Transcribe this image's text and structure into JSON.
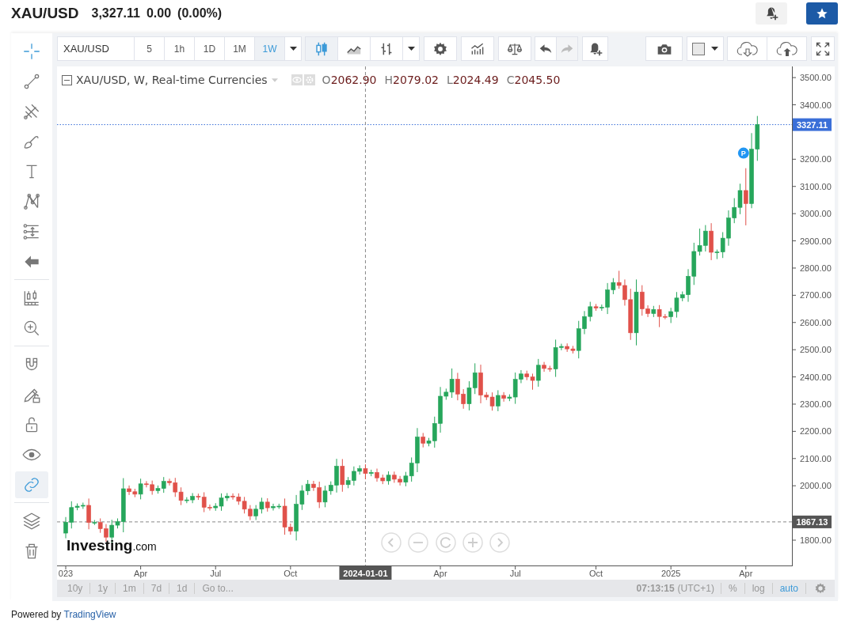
{
  "header": {
    "symbol": "XAU/USD",
    "price": "3,327.11",
    "change": "0.00",
    "change_percent": "(0.00%)"
  },
  "toolbar": {
    "symbol": "XAU/USD",
    "intervals": [
      {
        "label": "5",
        "selected": false
      },
      {
        "label": "1h",
        "selected": false
      },
      {
        "label": "1D",
        "selected": false
      },
      {
        "label": "1M",
        "selected": false
      },
      {
        "label": "1W",
        "selected": true
      }
    ],
    "chart_types": [
      {
        "kind": "candles",
        "selected": true
      },
      {
        "kind": "area",
        "selected": false
      },
      {
        "kind": "bars",
        "selected": false
      }
    ],
    "undo": {
      "disabled": false
    },
    "redo": {
      "disabled": true
    }
  },
  "left_toolbar": {
    "groups": [
      [
        {
          "kind": "crosshair",
          "active": true
        },
        {
          "kind": "trend-line",
          "active": false
        },
        {
          "kind": "pitchfork",
          "active": false
        },
        {
          "kind": "brush",
          "active": false
        },
        {
          "kind": "text",
          "active": false
        },
        {
          "kind": "pattern",
          "active": false
        },
        {
          "kind": "fib",
          "active": false
        },
        {
          "kind": "arrow",
          "active": false
        }
      ],
      [
        {
          "kind": "measure",
          "active": false
        },
        {
          "kind": "zoom",
          "active": false
        }
      ],
      [
        {
          "kind": "magnet",
          "active": false
        },
        {
          "kind": "pencil-lock",
          "active": false
        },
        {
          "kind": "lock",
          "active": false
        },
        {
          "kind": "eye",
          "active": false
        },
        {
          "kind": "link",
          "active": true
        }
      ],
      [
        {
          "kind": "layers",
          "active": false
        },
        {
          "kind": "trash",
          "active": false
        }
      ]
    ]
  },
  "legend": {
    "title": "XAU/USD, W, Real-time Currencies",
    "values": [
      {
        "label": "O",
        "value": "2062.90"
      },
      {
        "label": "H",
        "value": "2079.02"
      },
      {
        "label": "L",
        "value": "2024.49"
      },
      {
        "label": "C",
        "value": "2045.50"
      }
    ]
  },
  "price_axis": {
    "crosshair_price": "1867.13"
  },
  "crosshair": {
    "time": "2024-01-01"
  },
  "marker": {
    "label": "P"
  },
  "chart": {
    "logo": {
      "name": "Investing",
      "suffix": ".com"
    },
    "chart_data": {
      "type": "candlestick",
      "ylim": [
        1707,
        3541
      ],
      "ref_lines": [
        {
          "axis": "y",
          "value": 3327.11,
          "label": "3327.11",
          "color": "#3a6fd8"
        }
      ],
      "yticks": [
        {
          "value": 1800,
          "label": "1800.00"
        },
        {
          "value": 2000,
          "label": "2000.00"
        },
        {
          "value": 2100,
          "label": "2100.00"
        },
        {
          "value": 2200,
          "label": "2200.00"
        },
        {
          "value": 2300,
          "label": "2300.00"
        },
        {
          "value": 2400,
          "label": "2400.00"
        },
        {
          "value": 2500,
          "label": "2500.00"
        },
        {
          "value": 2600,
          "label": "2600.00"
        },
        {
          "value": 2700,
          "label": "2700.00"
        },
        {
          "value": 2800,
          "label": "2800.00"
        },
        {
          "value": 2900,
          "label": "2900.00"
        },
        {
          "value": 3000,
          "label": "3000.00"
        },
        {
          "value": 3100,
          "label": "3100.00"
        },
        {
          "value": 3200,
          "label": "3200.00"
        },
        {
          "value": 3400,
          "label": "3400.00"
        },
        {
          "value": 3500,
          "label": "3500.00"
        }
      ],
      "categories": [
        "023",
        null,
        null,
        null,
        null,
        null,
        null,
        null,
        null,
        null,
        null,
        null,
        null,
        "Apr",
        null,
        null,
        null,
        null,
        null,
        null,
        null,
        null,
        null,
        null,
        null,
        null,
        "Jul",
        null,
        null,
        null,
        null,
        null,
        null,
        null,
        null,
        null,
        null,
        null,
        null,
        "Oct",
        null,
        null,
        null,
        null,
        null,
        null,
        null,
        null,
        null,
        null,
        null,
        null,
        null,
        null,
        null,
        null,
        null,
        null,
        null,
        null,
        null,
        null,
        null,
        null,
        null,
        "Apr",
        null,
        null,
        null,
        null,
        null,
        null,
        null,
        null,
        null,
        null,
        null,
        null,
        "Jul",
        null,
        null,
        null,
        null,
        null,
        null,
        null,
        null,
        null,
        null,
        null,
        null,
        null,
        "Oct",
        null,
        null,
        null,
        null,
        null,
        null,
        null,
        null,
        null,
        null,
        null,
        null,
        "2025",
        null,
        null,
        null,
        null,
        null,
        null,
        null,
        null,
        null,
        null,
        null,
        null,
        "Apr",
        null,
        null
      ],
      "ohlc": [
        [
          1826,
          1885,
          1807,
          1866
        ],
        [
          1866,
          1943,
          1843,
          1920
        ],
        [
          1920,
          1935,
          1910,
          1925
        ],
        [
          1925,
          1938,
          1915,
          1928
        ],
        [
          1928,
          1953,
          1840,
          1865
        ],
        [
          1865,
          1874,
          1856,
          1865
        ],
        [
          1865,
          1880,
          1827,
          1842
        ],
        [
          1842,
          1859,
          1794,
          1811
        ],
        [
          1811,
          1875,
          1791,
          1855
        ],
        [
          1855,
          1880,
          1843,
          1868
        ],
        [
          1868,
          2028,
          1829,
          1989
        ],
        [
          1989,
          2001,
          1966,
          1978
        ],
        [
          1978,
          1989,
          1958,
          1969
        ],
        [
          1969,
          2026,
          1950,
          2007
        ],
        [
          2007,
          2017,
          1994,
          2004
        ],
        [
          2004,
          2019,
          1967,
          1982
        ],
        [
          1982,
          2001,
          1971,
          1990
        ],
        [
          1990,
          2032,
          1974,
          2016
        ],
        [
          2016,
          2026,
          2001,
          2011
        ],
        [
          2011,
          2029,
          1959,
          1977
        ],
        [
          1977,
          1994,
          1929,
          1946
        ],
        [
          1946,
          1958,
          1936,
          1948
        ],
        [
          1948,
          1973,
          1936,
          1961
        ],
        [
          1961,
          1971,
          1948,
          1958
        ],
        [
          1958,
          1976,
          1903,
          1921
        ],
        [
          1921,
          1931,
          1909,
          1919
        ],
        [
          1919,
          1936,
          1908,
          1925
        ],
        [
          1925,
          1972,
          1908,
          1955
        ],
        [
          1955,
          1973,
          1944,
          1962
        ],
        [
          1962,
          1972,
          1949,
          1959
        ],
        [
          1959,
          1972,
          1930,
          1943
        ],
        [
          1943,
          1959,
          1898,
          1914
        ],
        [
          1914,
          1929,
          1874,
          1889
        ],
        [
          1889,
          1929,
          1874,
          1914
        ],
        [
          1914,
          1956,
          1898,
          1940
        ],
        [
          1940,
          1954,
          1905,
          1919
        ],
        [
          1919,
          1934,
          1909,
          1924
        ],
        [
          1924,
          1934,
          1915,
          1925
        ],
        [
          1925,
          1953,
          1820,
          1848
        ],
        [
          1848,
          1861,
          1820,
          1833
        ],
        [
          1833,
          1966,
          1799,
          1932
        ],
        [
          1932,
          2002,
          1911,
          1981
        ],
        [
          1981,
          2021,
          1966,
          2006
        ],
        [
          2006,
          2018,
          1981,
          1993
        ],
        [
          1993,
          2015,
          1918,
          1940
        ],
        [
          1940,
          2000,
          1921,
          1981
        ],
        [
          1981,
          2016,
          1967,
          2002
        ],
        [
          2002,
          2099,
          1975,
          2072
        ],
        [
          2072,
          2098,
          1978,
          2004
        ],
        [
          2004,
          2032,
          1991,
          2019
        ],
        [
          2019,
          2071,
          2001,
          2053
        ],
        [
          2053,
          2075,
          2041,
          2063
        ],
        [
          2063,
          2079,
          2024,
          2045
        ],
        [
          2045,
          2059,
          2035,
          2049
        ],
        [
          2049,
          2063,
          2015,
          2029
        ],
        [
          2029,
          2041,
          2006,
          2018
        ],
        [
          2018,
          2053,
          2004,
          2039
        ],
        [
          2039,
          2052,
          2011,
          2024
        ],
        [
          2024,
          2036,
          2001,
          2013
        ],
        [
          2013,
          2051,
          1998,
          2036
        ],
        [
          2036,
          2104,
          2015,
          2083
        ],
        [
          2083,
          2212,
          2050,
          2179
        ],
        [
          2179,
          2194,
          2141,
          2156
        ],
        [
          2156,
          2176,
          2145,
          2165
        ],
        [
          2165,
          2254,
          2140,
          2229
        ],
        [
          2229,
          2363,
          2195,
          2329
        ],
        [
          2329,
          2357,
          2316,
          2344
        ],
        [
          2344,
          2431,
          2323,
          2392
        ],
        [
          2392,
          2415,
          2314,
          2337
        ],
        [
          2337,
          2355,
          2283,
          2301
        ],
        [
          2301,
          2384,
          2277,
          2360
        ],
        [
          2360,
          2450,
          2337,
          2415
        ],
        [
          2415,
          2445,
          2303,
          2333
        ],
        [
          2333,
          2344,
          2315,
          2326
        ],
        [
          2326,
          2343,
          2276,
          2293
        ],
        [
          2293,
          2351,
          2274,
          2332
        ],
        [
          2332,
          2344,
          2309,
          2321
        ],
        [
          2321,
          2336,
          2311,
          2326
        ],
        [
          2326,
          2416,
          2301,
          2391
        ],
        [
          2391,
          2425,
          2377,
          2411
        ],
        [
          2411,
          2423,
          2388,
          2400
        ],
        [
          2400,
          2412,
          2353,
          2387
        ],
        [
          2387,
          2466,
          2364,
          2443
        ],
        [
          2443,
          2455,
          2419,
          2431
        ],
        [
          2431,
          2441,
          2419,
          2429
        ],
        [
          2429,
          2537,
          2400,
          2508
        ],
        [
          2508,
          2522,
          2498,
          2512
        ],
        [
          2512,
          2523,
          2492,
          2503
        ],
        [
          2503,
          2514,
          2486,
          2497
        ],
        [
          2497,
          2606,
          2468,
          2577
        ],
        [
          2577,
          2642,
          2557,
          2622
        ],
        [
          2622,
          2676,
          2604,
          2658
        ],
        [
          2658,
          2668,
          2643,
          2653
        ],
        [
          2653,
          2666,
          2643,
          2656
        ],
        [
          2656,
          2745,
          2631,
          2720
        ],
        [
          2720,
          2763,
          2704,
          2747
        ],
        [
          2747,
          2790,
          2724,
          2736
        ],
        [
          2736,
          2758,
          2662,
          2684
        ],
        [
          2684,
          2724,
          2536,
          2562
        ],
        [
          2562,
          2758,
          2516,
          2712
        ],
        [
          2712,
          2737,
          2625,
          2650
        ],
        [
          2650,
          2663,
          2620,
          2633
        ],
        [
          2633,
          2661,
          2620,
          2648
        ],
        [
          2648,
          2664,
          2583,
          2622
        ],
        [
          2622,
          2631,
          2612,
          2621
        ],
        [
          2621,
          2654,
          2598,
          2640
        ],
        [
          2640,
          2712,
          2618,
          2690
        ],
        [
          2690,
          2714,
          2678,
          2702
        ],
        [
          2702,
          2796,
          2676,
          2770
        ],
        [
          2770,
          2893,
          2738,
          2861
        ],
        [
          2861,
          2945,
          2846,
          2883
        ],
        [
          2883,
          2958,
          2861,
          2936
        ],
        [
          2936,
          2965,
          2829,
          2858
        ],
        [
          2858,
          2868,
          2833,
          2859
        ],
        [
          2859,
          2932,
          2837,
          2910
        ],
        [
          2910,
          3012,
          2882,
          2984
        ],
        [
          2984,
          3057,
          2965,
          3023
        ],
        [
          3023,
          3110,
          2998,
          3085
        ],
        [
          3085,
          3167,
          2957,
          3037
        ],
        [
          3037,
          3296,
          3020,
          3237
        ],
        [
          3237,
          3359,
          3194,
          3327
        ]
      ]
    }
  },
  "bottom_bar": {
    "ranges": [
      "10y",
      "1y",
      "1m",
      "7d",
      "1d"
    ],
    "goto": "Go to...",
    "time": "07:13:15",
    "timezone": "(UTC+1)",
    "scale_options": [
      {
        "label": "%",
        "selected": false
      },
      {
        "label": "log",
        "selected": false
      },
      {
        "label": "auto",
        "selected": true
      }
    ]
  },
  "footer": {
    "prefix": "Powered by",
    "link": "TradingView"
  }
}
